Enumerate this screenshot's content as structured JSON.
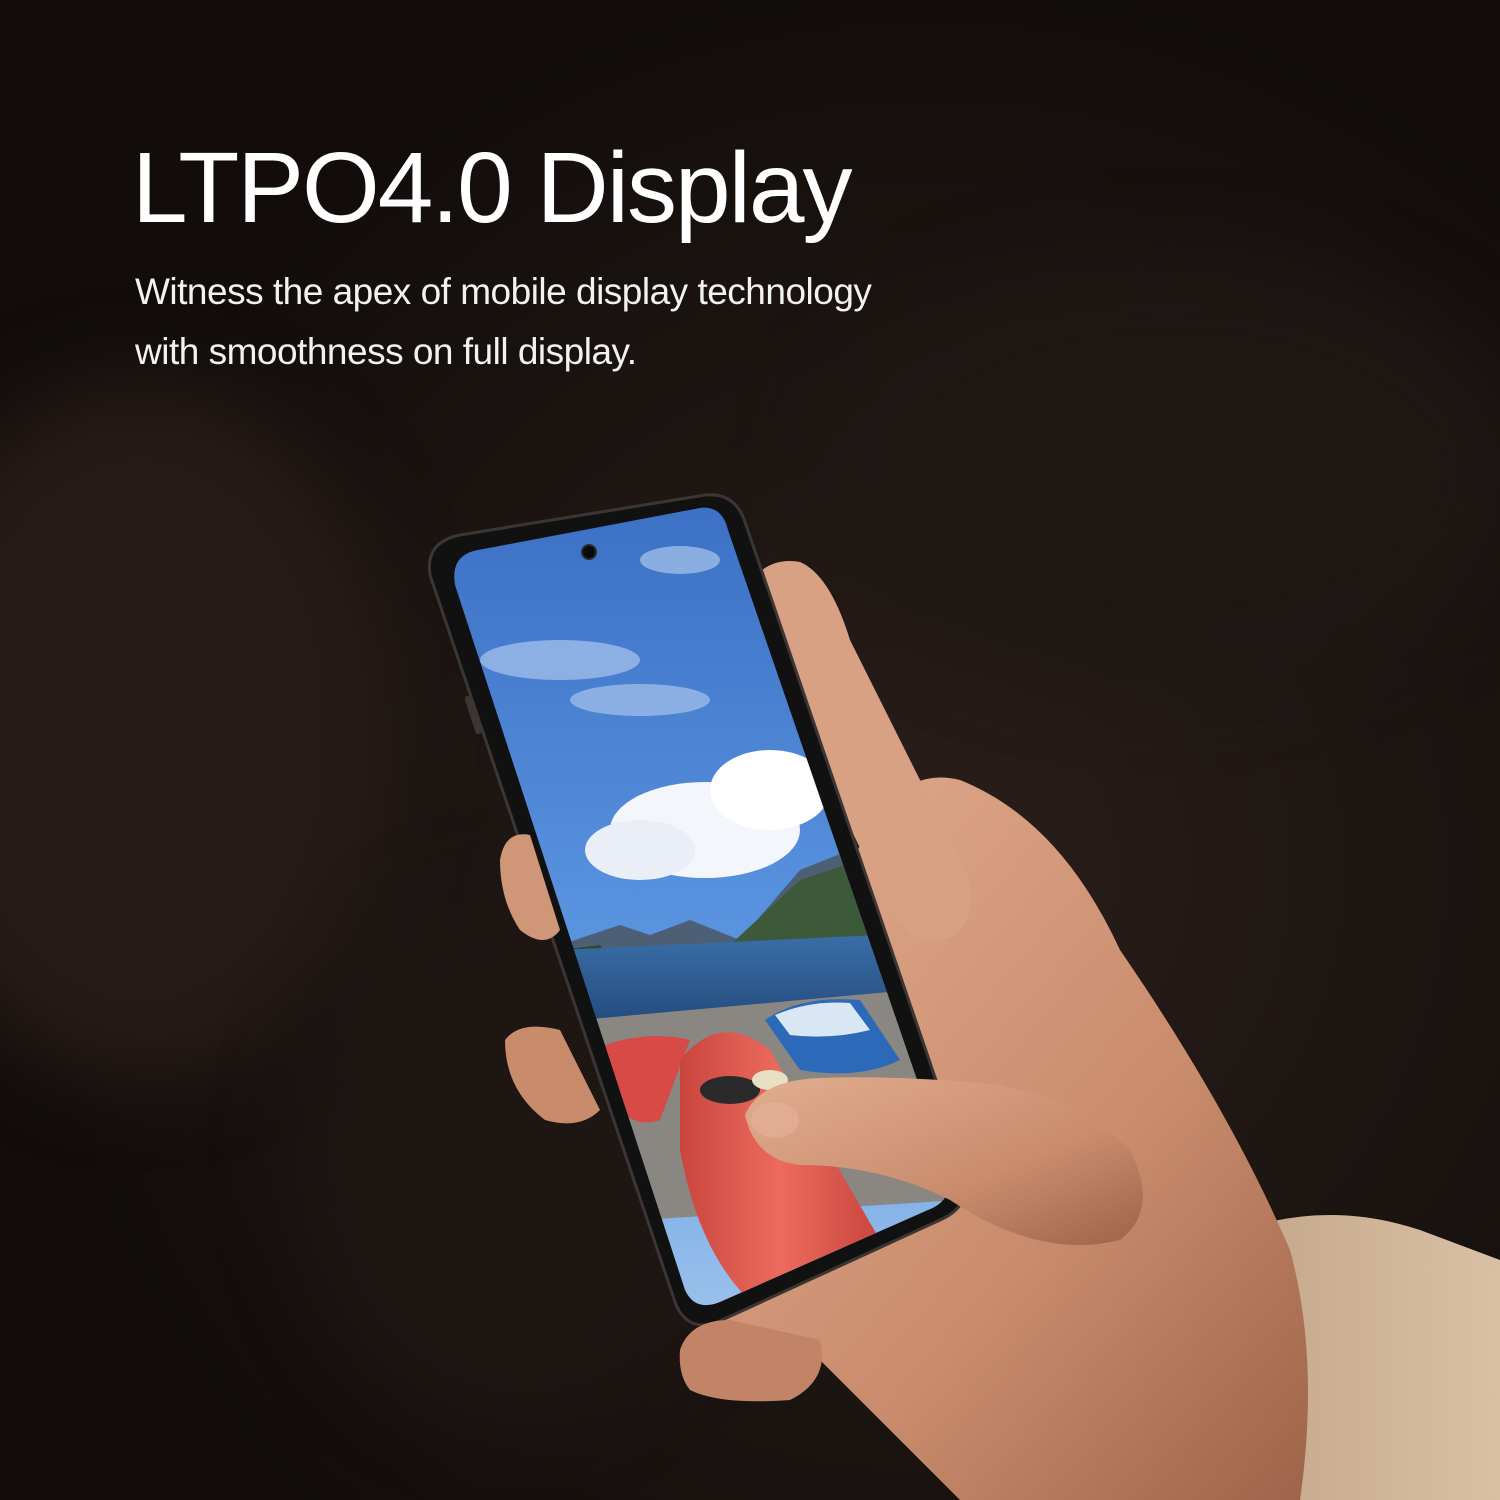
{
  "headline": "LTPO4.0 Display",
  "subline_1": "Witness the apex of mobile display technology",
  "subline_2": "with smoothness on full display.",
  "colors": {
    "background": "#1b1412",
    "text": "#ffffff",
    "sky": "#3f7ad0",
    "water": "#2c5f9c",
    "kayak": "#e4574f",
    "skin": "#d69a7c",
    "sleeve": "#c9ad92"
  },
  "icons": {
    "camera": "front-camera-icon"
  }
}
